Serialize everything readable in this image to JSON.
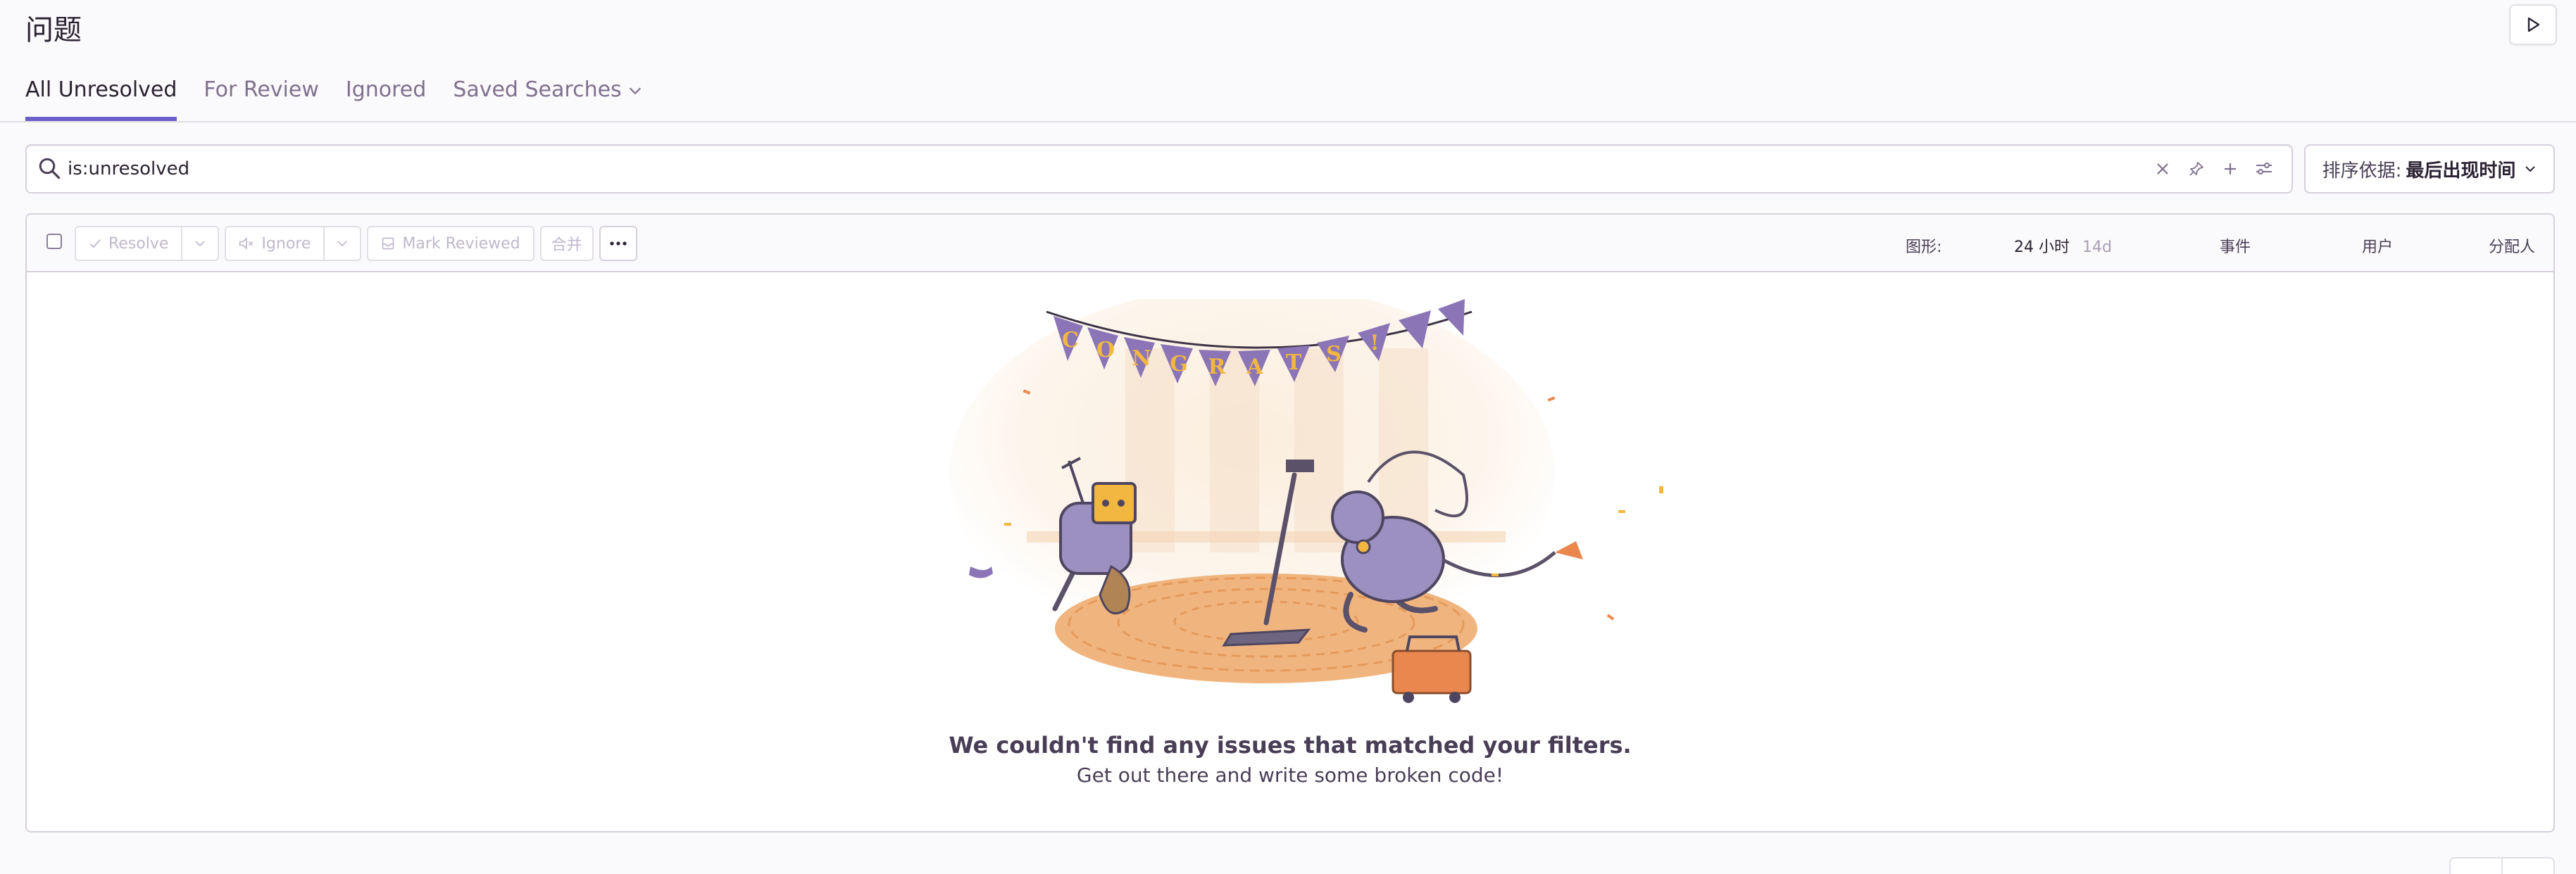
{
  "page": {
    "title": "问题"
  },
  "tabs": [
    {
      "label": "All Unresolved",
      "active": true
    },
    {
      "label": "For Review",
      "active": false
    },
    {
      "label": "Ignored",
      "active": false
    },
    {
      "label": "Saved Searches",
      "active": false
    }
  ],
  "search": {
    "query": "is:unresolved"
  },
  "sort": {
    "label": "排序依据:",
    "value": "最后出现时间"
  },
  "toolbar": {
    "resolve_label": "Resolve",
    "ignore_label": "Ignore",
    "mark_reviewed_label": "Mark Reviewed",
    "merge_label": "合并",
    "more_label": "···"
  },
  "columns": {
    "graph_label": "图形:",
    "period_active": "24 小时",
    "period_other": "14d",
    "events": "事件",
    "users": "用户",
    "assignee": "分配人"
  },
  "illustration": {
    "banner_letters": [
      "C",
      "O",
      "N",
      "G",
      "R",
      "A",
      "T",
      "S",
      "!"
    ]
  },
  "empty_state": {
    "title": "We couldn't find any issues that matched your filters.",
    "subtitle": "Get out there and write some broken code!"
  },
  "colors": {
    "accent": "#6c5fc7",
    "text": "#2b2233",
    "muted": "#80708f",
    "border": "#d6d0dc"
  }
}
